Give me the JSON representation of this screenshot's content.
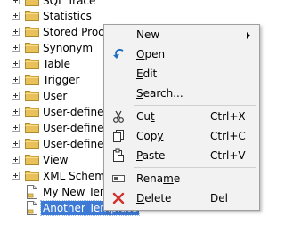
{
  "tree": {
    "items": [
      {
        "label": "SQL Trace",
        "type": "folder",
        "expandable": true
      },
      {
        "label": "Statistics",
        "type": "folder",
        "expandable": true
      },
      {
        "label": "Stored Proce",
        "type": "folder",
        "expandable": true
      },
      {
        "label": "Synonym",
        "type": "folder",
        "expandable": true
      },
      {
        "label": "Table",
        "type": "folder",
        "expandable": true
      },
      {
        "label": "Trigger",
        "type": "folder",
        "expandable": true
      },
      {
        "label": "User",
        "type": "folder",
        "expandable": true
      },
      {
        "label": "User-defined",
        "type": "folder",
        "expandable": true
      },
      {
        "label": "User-defined",
        "type": "folder",
        "expandable": true
      },
      {
        "label": "User-defined",
        "type": "folder",
        "expandable": true
      },
      {
        "label": "View",
        "type": "folder",
        "expandable": true
      },
      {
        "label": "XML Schema",
        "type": "folder",
        "expandable": true
      },
      {
        "label": "My New Tem",
        "type": "template",
        "expandable": false
      },
      {
        "label": "Another Template",
        "type": "template",
        "expandable": false,
        "selected": true
      }
    ]
  },
  "context_menu": {
    "new": {
      "label": "New",
      "has_submenu": true
    },
    "open": {
      "label_prefix": "",
      "label_underlined": "O",
      "label_rest": "pen",
      "icon": "open-arrow-icon"
    },
    "edit": {
      "label_prefix": "",
      "label_underlined": "E",
      "label_rest": "dit"
    },
    "search": {
      "label_prefix": "",
      "label_underlined": "S",
      "label_rest": "earch..."
    },
    "cut": {
      "label_prefix": "Cu",
      "label_underlined": "t",
      "label_rest": "",
      "shortcut": "Ctrl+X",
      "icon": "scissors-icon"
    },
    "copy": {
      "label_prefix": "Cop",
      "label_underlined": "y",
      "label_rest": "",
      "shortcut": "Ctrl+C",
      "icon": "copy-icon"
    },
    "paste": {
      "label_prefix": "",
      "label_underlined": "P",
      "label_rest": "aste",
      "shortcut": "Ctrl+V",
      "icon": "paste-icon"
    },
    "rename": {
      "label_prefix": "Rena",
      "label_underlined": "m",
      "label_rest": "e",
      "icon": "rename-icon"
    },
    "delete": {
      "label_prefix": "",
      "label_underlined": "D",
      "label_rest": "elete",
      "shortcut": "Del",
      "icon": "delete-x-icon"
    }
  },
  "colors": {
    "selection": "#3d7ad6",
    "folder": "#e8c15a",
    "menu_bg": "#f2f2f2",
    "delete_red": "#d0312d",
    "open_blue": "#1e6fc0"
  }
}
